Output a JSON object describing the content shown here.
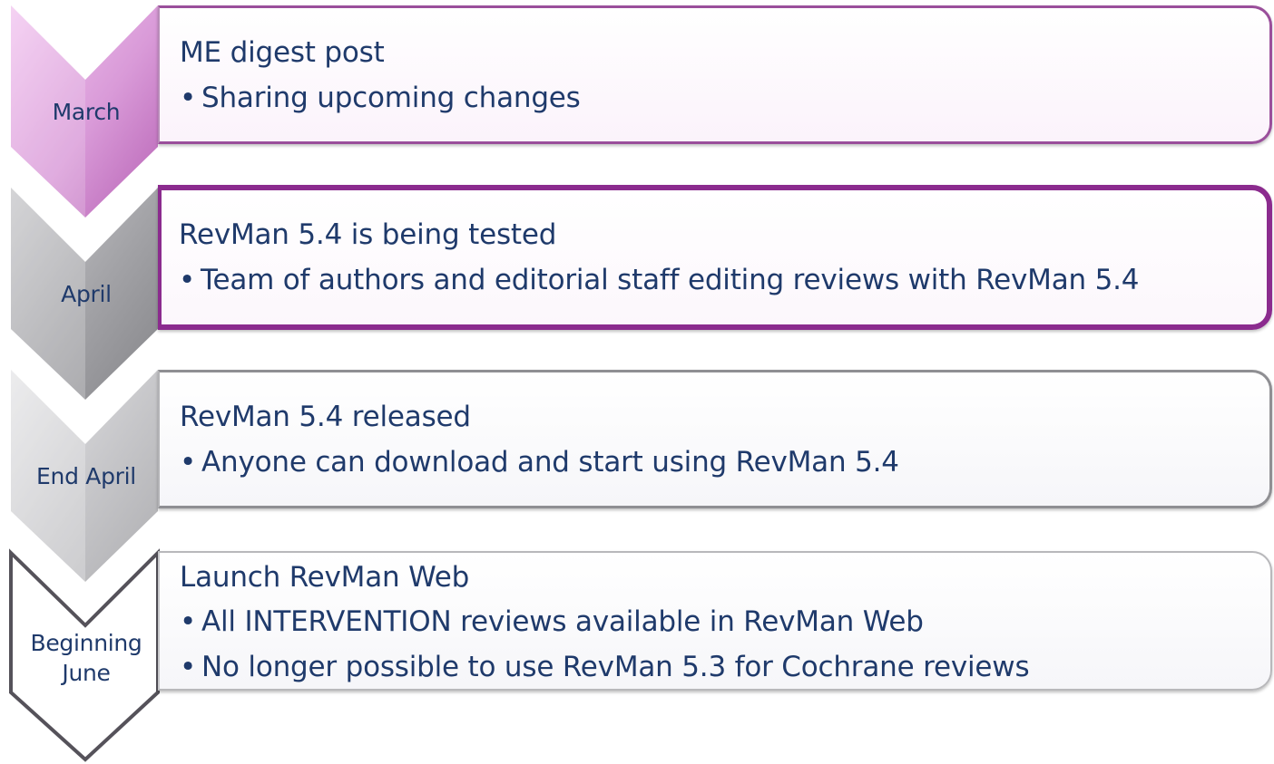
{
  "steps": [
    {
      "label": "March",
      "title": "ME digest post",
      "bullets": [
        "Sharing upcoming changes"
      ]
    },
    {
      "label": "April",
      "title": "RevMan 5.4 is being tested",
      "bullets": [
        "Team of authors and editorial staff editing reviews with RevMan 5.4"
      ]
    },
    {
      "label": "End April",
      "title": "RevMan 5.4 released",
      "bullets": [
        "Anyone can download and start using RevMan 5.4"
      ]
    },
    {
      "label": "Beginning June",
      "title": "Launch RevMan Web",
      "bullets": [
        "All INTERVENTION reviews available in RevMan Web",
        "No longer possible to use RevMan 5.3 for Cochrane reviews"
      ]
    }
  ],
  "colors": {
    "text": "#1f3a6b",
    "purple": "#8b2b8e",
    "purple_light": "#e6a9e6",
    "gray_dark": "#8d8d90",
    "gray_mid": "#a9a9ac",
    "gray_light": "#cfcfd2",
    "outline_dark": "#55525a"
  }
}
